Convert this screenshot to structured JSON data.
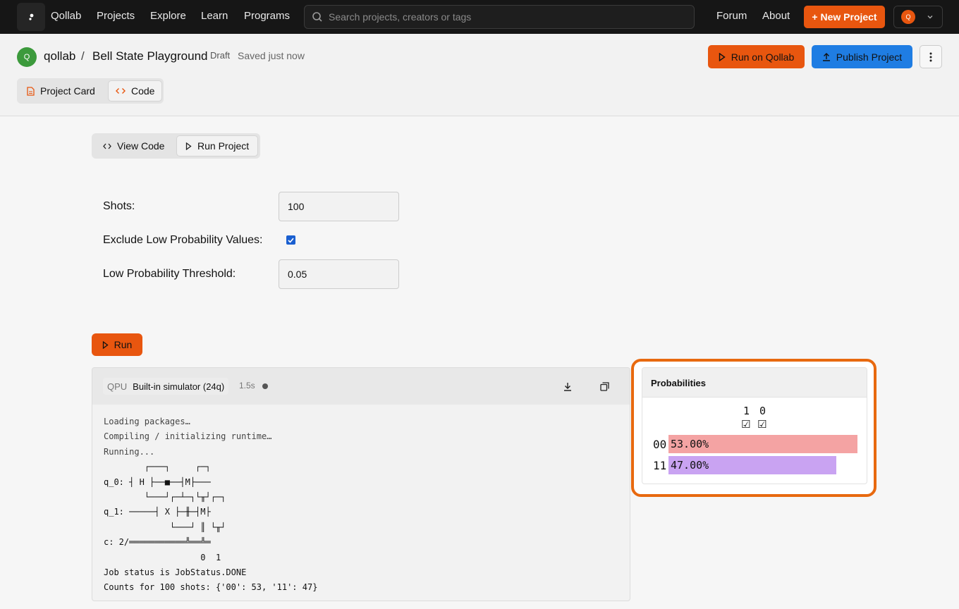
{
  "nav": {
    "brand": "Qollab",
    "links": [
      "Projects",
      "Explore",
      "Learn",
      "Programs"
    ],
    "search_placeholder": "Search projects, creators or tags",
    "right_links": [
      "Forum",
      "About"
    ],
    "new_project": "+ New Project",
    "user_initial": "Q"
  },
  "header": {
    "org_initial": "Q",
    "org": "qollab",
    "separator": "/",
    "project": "Bell State Playground",
    "status": "Draft",
    "saved": "Saved just now",
    "run_on_qollab": "Run on Qollab",
    "publish": "Publish Project",
    "tabs": [
      "Project Card",
      "Code"
    ]
  },
  "subtabs": [
    "View Code",
    "Run Project"
  ],
  "form": {
    "shots_label": "Shots:",
    "shots_value": "100",
    "exclude_label": "Exclude Low Probability Values:",
    "exclude_checked": true,
    "threshold_label": "Low Probability Threshold:",
    "threshold_value": "0.05"
  },
  "run_label": "Run",
  "output": {
    "qpu_tag": "QPU",
    "backend": "Built-in simulator (24q)",
    "duration": "1.5s",
    "lines": [
      "Loading packages…",
      "Compiling / initializing runtime…",
      "Running..."
    ],
    "circuit": "        ┌───┐     ┌─┐   \nq_0: ┤ H ├──■──┤M├───\n        └───┘┌─┴─┐└╥┘┌─┐\nq_1: ─────┤ X ├─╫─┤M├\n             └───┘ ║ └╥┘\nc: 2/═══════════╩══╩═\n                   0  1 ",
    "status_line": "Job status is JobStatus.DONE",
    "counts_line": "Counts for 100 shots: {'00': 53, '11': 47}"
  },
  "probabilities": {
    "title": "Probabilities",
    "bit_labels": [
      "1",
      "0"
    ],
    "bit_checks": [
      "☑",
      "☑"
    ],
    "rows": [
      {
        "state": "00",
        "label": "53.00%",
        "value": 0.53,
        "color": "#f4a3a3"
      },
      {
        "state": "11",
        "label": "47.00%",
        "value": 0.47,
        "color": "#c9a3f2"
      }
    ]
  },
  "colors": {
    "accent": "#e8560f",
    "publish": "#1f7de3",
    "highlight": "#e8690f"
  }
}
